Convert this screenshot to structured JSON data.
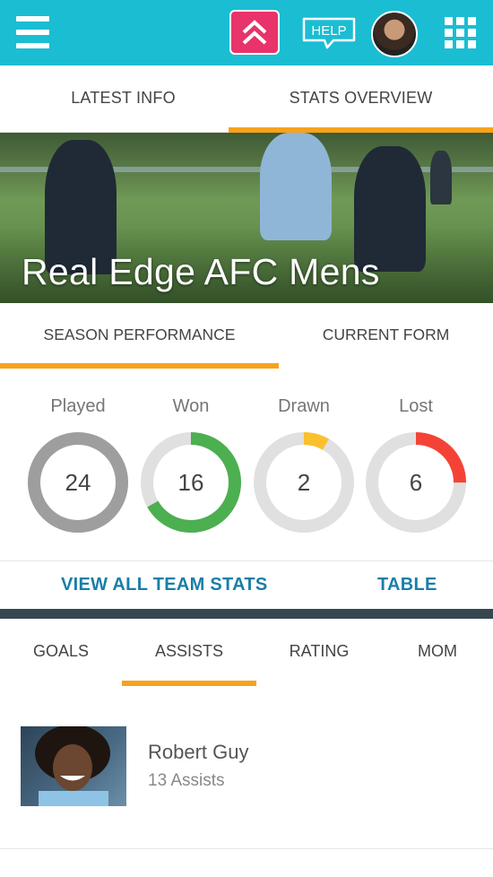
{
  "header": {
    "menu_icon": "hamburger-menu-icon",
    "logo_icon": "double-chevron-up-icon",
    "help_label": "HELP",
    "apps_icon": "grid-icon",
    "brand_color": "#1bbdd2",
    "logo_color": "#e8336b"
  },
  "main_tabs": [
    {
      "label": "LATEST INFO",
      "active": false
    },
    {
      "label": "STATS OVERVIEW",
      "active": true
    }
  ],
  "hero": {
    "team_name": "Real Edge AFC Mens"
  },
  "performance_tabs": [
    {
      "label": "SEASON PERFORMANCE",
      "active": true
    },
    {
      "label": "CURRENT FORM",
      "active": false
    }
  ],
  "stats": [
    {
      "label": "Played",
      "value": "24",
      "fraction": 1.0,
      "color": "#9e9e9e"
    },
    {
      "label": "Won",
      "value": "16",
      "fraction": 0.667,
      "color": "#4caf50"
    },
    {
      "label": "Drawn",
      "value": "2",
      "fraction": 0.083,
      "color": "#fbc02d"
    },
    {
      "label": "Lost",
      "value": "6",
      "fraction": 0.25,
      "color": "#f44336"
    }
  ],
  "links": {
    "view_all": "VIEW ALL TEAM STATS",
    "table": "TABLE"
  },
  "stat_tabs": [
    {
      "label": "GOALS",
      "active": false
    },
    {
      "label": "ASSISTS",
      "active": true
    },
    {
      "label": "RATING",
      "active": false
    },
    {
      "label": "MOM",
      "active": false
    }
  ],
  "top_player": {
    "name": "Robert Guy",
    "detail": "13 Assists"
  },
  "colors": {
    "accent": "#f7a21c",
    "link": "#1a7ea8",
    "ring_track": "#e0e0e0",
    "divider": "#36474f"
  }
}
